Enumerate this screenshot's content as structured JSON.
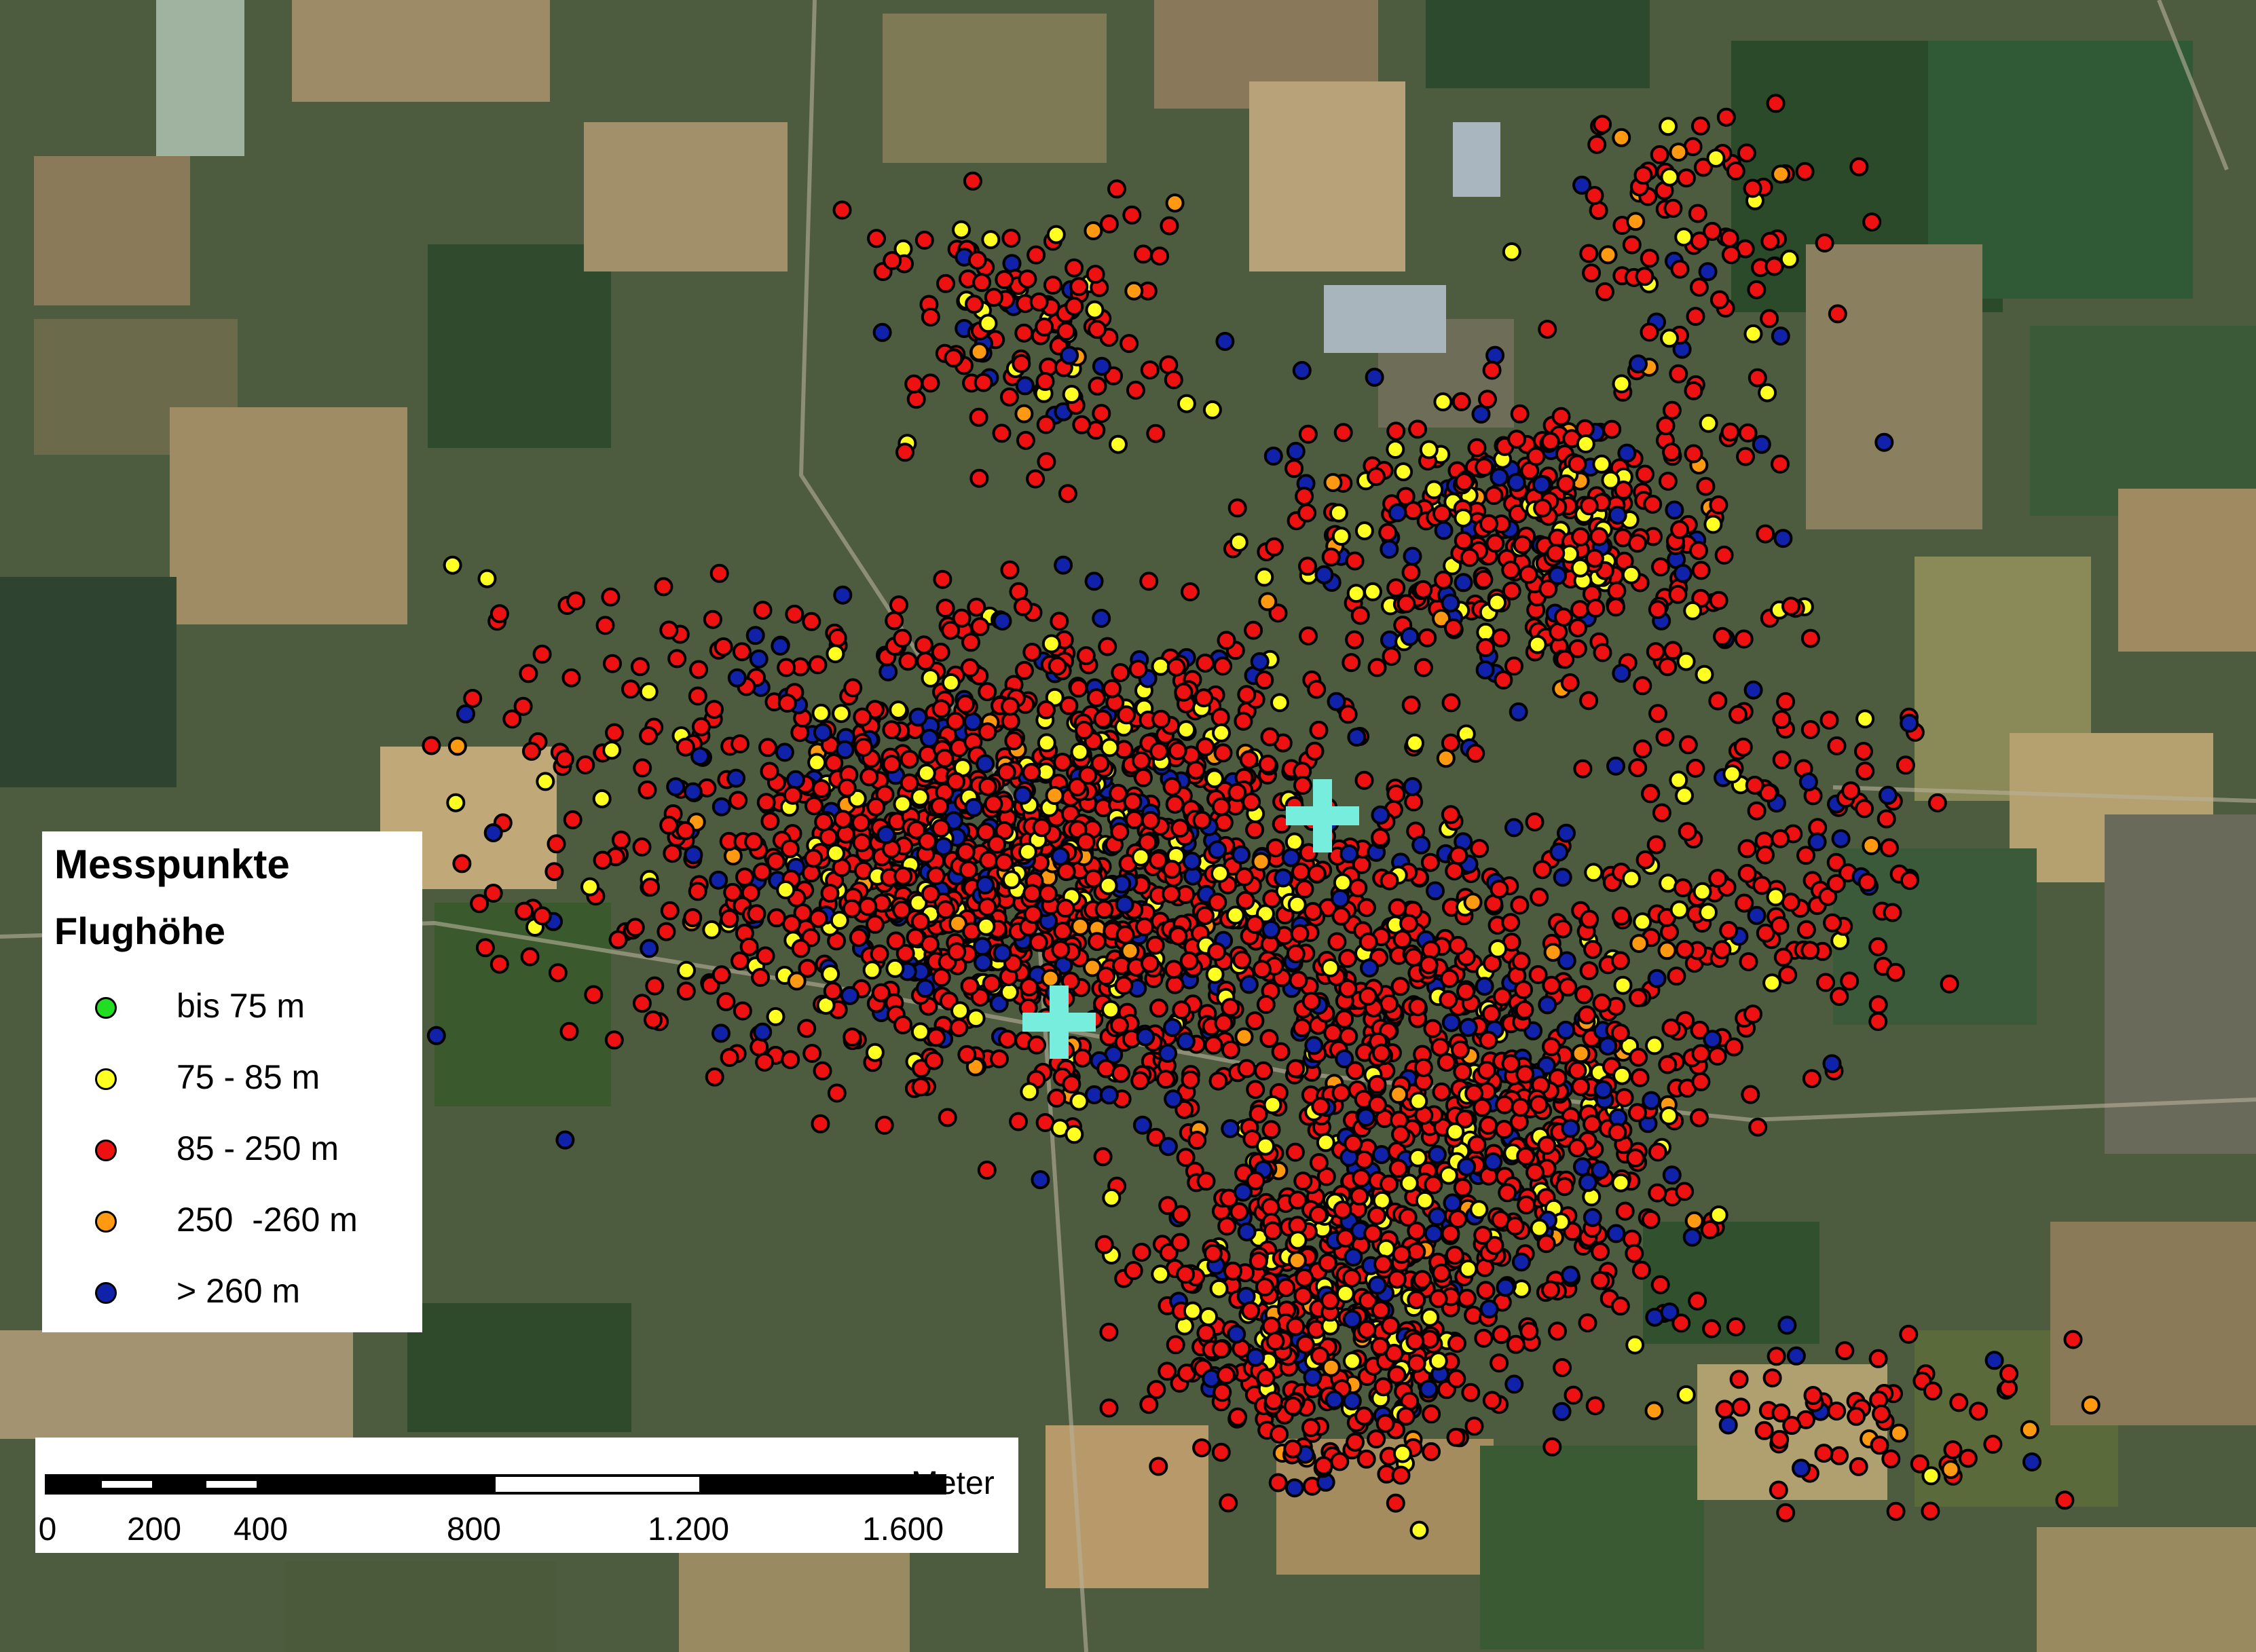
{
  "legend": {
    "title": "Messpunkte",
    "subtitle": "Flughöhe",
    "items": [
      {
        "label": "bis 75 m",
        "color": "#22dd22"
      },
      {
        "label": "75 - 85 m",
        "color": "#ffff22"
      },
      {
        "label": "85 - 250 m",
        "color": "#ee1111"
      },
      {
        "label": "250  -260 m",
        "color": "#ff9911"
      },
      {
        "label": "> 260 m",
        "color": "#1122aa"
      }
    ]
  },
  "scale": {
    "unit": "Meter",
    "ticks": [
      "0",
      "200",
      "400",
      "800",
      "1.200",
      "1.600"
    ]
  },
  "markers": {
    "color": "#77eedd",
    "count": 2
  }
}
